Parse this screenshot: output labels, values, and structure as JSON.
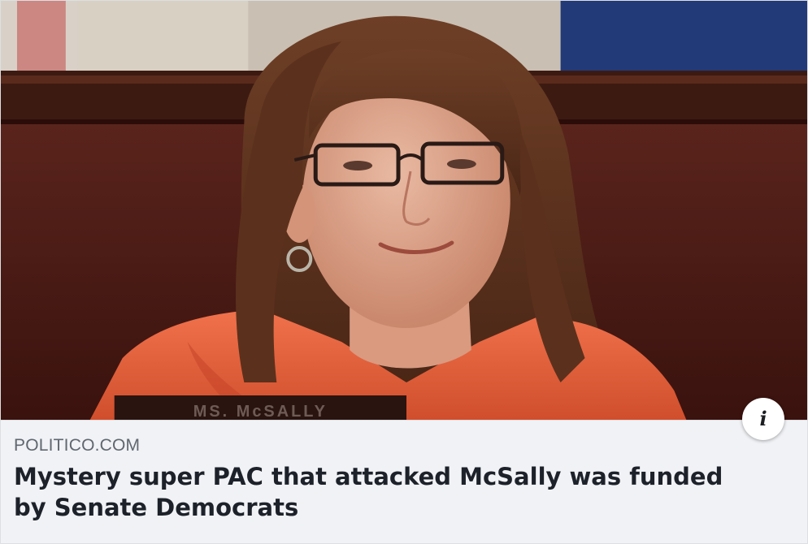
{
  "link_preview": {
    "image_alt": "Woman with glasses and hoop earrings wearing an orange jacket, seated at a hearing table",
    "nameplate_text": "MS. McSALLY",
    "source_domain": "POLITICO.COM",
    "headline": "Mystery super PAC that attacked McSally was funded by Senate Democrats",
    "info_icon_glyph": "i"
  },
  "colors": {
    "caption_bg": "#f0f2f5",
    "domain_text": "#606770",
    "headline_text": "#1d2129",
    "jacket": "#e8603c",
    "backdrop": "#4a1a14"
  }
}
